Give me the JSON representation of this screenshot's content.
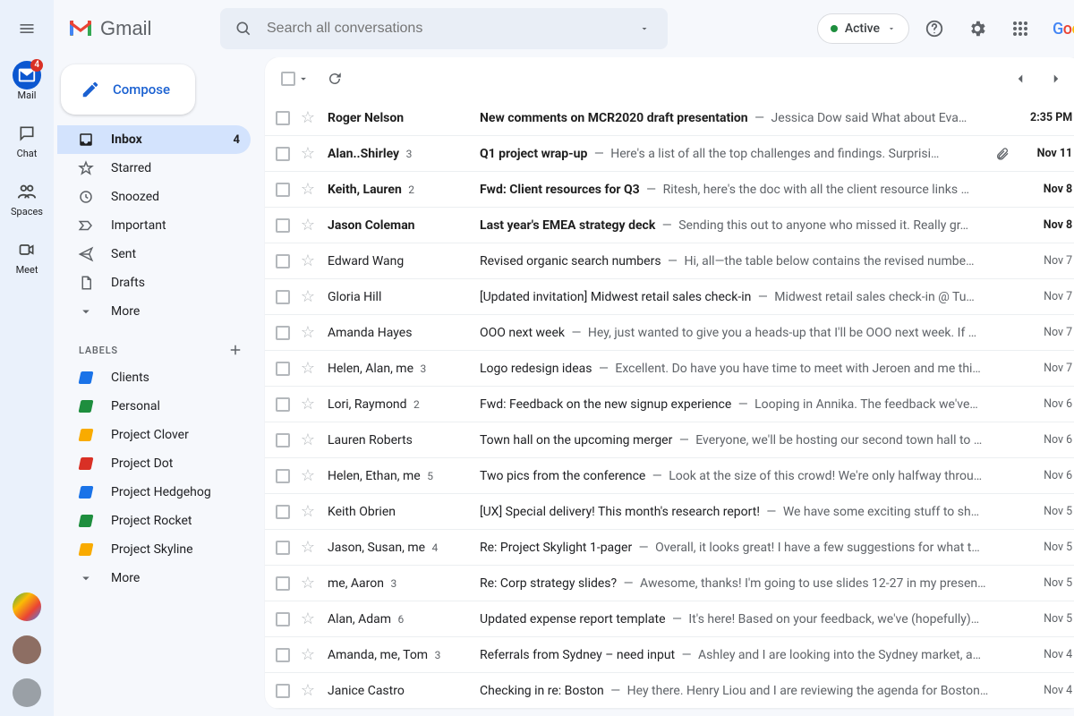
{
  "header": {
    "product": "Gmail",
    "search_placeholder": "Search all conversations",
    "status_label": "Active",
    "brand_word": "Google"
  },
  "apprail": {
    "items": [
      {
        "key": "mail",
        "label": "Mail",
        "badge": "4",
        "active": true
      },
      {
        "key": "chat",
        "label": "Chat"
      },
      {
        "key": "spaces",
        "label": "Spaces"
      },
      {
        "key": "meet",
        "label": "Meet"
      }
    ]
  },
  "sidebar": {
    "compose": "Compose",
    "nav": [
      {
        "key": "inbox",
        "label": "Inbox",
        "count": "4",
        "active": true
      },
      {
        "key": "starred",
        "label": "Starred"
      },
      {
        "key": "snoozed",
        "label": "Snoozed"
      },
      {
        "key": "important",
        "label": "Important"
      },
      {
        "key": "sent",
        "label": "Sent"
      },
      {
        "key": "drafts",
        "label": "Drafts"
      },
      {
        "key": "more",
        "label": "More"
      }
    ],
    "labels_header": "LABELS",
    "labels": [
      {
        "label": "Clients",
        "color": "#1a73e8"
      },
      {
        "label": "Personal",
        "color": "#1e8e3e"
      },
      {
        "label": "Project Clover",
        "color": "#f9ab00"
      },
      {
        "label": "Project Dot",
        "color": "#d93025"
      },
      {
        "label": "Project Hedgehog",
        "color": "#1a73e8"
      },
      {
        "label": "Project Rocket",
        "color": "#1e8e3e"
      },
      {
        "label": "Project Skyline",
        "color": "#f9ab00"
      }
    ],
    "labels_more": "More"
  },
  "mail": [
    {
      "unread": true,
      "from": "Roger Nelson",
      "count": "",
      "subject": "New comments on MCR2020 draft presentation",
      "snippet": "Jessica Dow said What about Eva…",
      "date": "2:35 PM",
      "attach": false
    },
    {
      "unread": true,
      "from": "Alan..Shirley",
      "count": "3",
      "subject": "Q1 project wrap-up",
      "snippet": "Here's a list of all the top challenges and findings. Surprisi…",
      "date": "Nov 11",
      "attach": true
    },
    {
      "unread": true,
      "from": "Keith, Lauren",
      "count": "2",
      "subject": "Fwd: Client resources for Q3",
      "snippet": "Ritesh, here's the doc with all the client resource links …",
      "date": "Nov 8",
      "attach": false
    },
    {
      "unread": true,
      "from": "Jason Coleman",
      "count": "",
      "subject": "Last year's EMEA strategy deck",
      "snippet": "Sending this out to anyone who missed it. Really gr…",
      "date": "Nov 8",
      "attach": false
    },
    {
      "unread": false,
      "from": "Edward Wang",
      "count": "",
      "subject": "Revised organic search numbers",
      "snippet": "Hi, all—the table below contains the revised numbe…",
      "date": "Nov 7",
      "attach": false
    },
    {
      "unread": false,
      "from": "Gloria Hill",
      "count": "",
      "subject": "[Updated invitation] Midwest retail sales check-in",
      "snippet": "Midwest retail sales check-in @ Tu…",
      "date": "Nov 7",
      "attach": false
    },
    {
      "unread": false,
      "from": "Amanda Hayes",
      "count": "",
      "subject": "OOO next week",
      "snippet": "Hey, just wanted to give you a heads-up that I'll be OOO next week. If …",
      "date": "Nov 7",
      "attach": false
    },
    {
      "unread": false,
      "from": "Helen, Alan, me",
      "count": "3",
      "subject": "Logo redesign ideas",
      "snippet": "Excellent. Do have you have time to meet with Jeroen and me thi…",
      "date": "Nov 7",
      "attach": false
    },
    {
      "unread": false,
      "from": "Lori, Raymond",
      "count": "2",
      "subject": "Fwd: Feedback on the new signup experience",
      "snippet": "Looping in Annika. The feedback we've…",
      "date": "Nov 6",
      "attach": false
    },
    {
      "unread": false,
      "from": "Lauren Roberts",
      "count": "",
      "subject": "Town hall on the upcoming merger",
      "snippet": "Everyone, we'll be hosting our second town hall to …",
      "date": "Nov 6",
      "attach": false
    },
    {
      "unread": false,
      "from": "Helen, Ethan, me",
      "count": "5",
      "subject": "Two pics from the conference",
      "snippet": "Look at the size of this crowd! We're only halfway throu…",
      "date": "Nov 6",
      "attach": false
    },
    {
      "unread": false,
      "from": "Keith Obrien",
      "count": "",
      "subject": "[UX] Special delivery! This month's research report!",
      "snippet": "We have some exciting stuff to sh…",
      "date": "Nov 5",
      "attach": false
    },
    {
      "unread": false,
      "from": "Jason, Susan, me",
      "count": "4",
      "subject": "Re: Project Skylight 1-pager",
      "snippet": "Overall, it looks great! I have a few suggestions for what t…",
      "date": "Nov 5",
      "attach": false
    },
    {
      "unread": false,
      "from": "me, Aaron",
      "count": "3",
      "subject": "Re: Corp strategy slides?",
      "snippet": "Awesome, thanks! I'm going to use slides 12-27 in my presen…",
      "date": "Nov 5",
      "attach": false
    },
    {
      "unread": false,
      "from": "Alan, Adam",
      "count": "6",
      "subject": "Updated expense report template",
      "snippet": "It's here! Based on your feedback, we've (hopefully)…",
      "date": "Nov 5",
      "attach": false
    },
    {
      "unread": false,
      "from": "Amanda, me, Tom",
      "count": "3",
      "subject": "Referrals from Sydney – need input",
      "snippet": "Ashley and I are looking into the Sydney market, a…",
      "date": "Nov 4",
      "attach": false
    },
    {
      "unread": false,
      "from": "Janice Castro",
      "count": "",
      "subject": "Checking in re: Boston",
      "snippet": "Hey there. Henry Liou and I are reviewing the agenda for Boston…",
      "date": "Nov 4",
      "attach": false
    }
  ],
  "rightrail": {
    "items": [
      {
        "key": "calendar",
        "color": "#4285f4"
      },
      {
        "key": "keep",
        "color": "#fbbc04"
      },
      {
        "key": "tasks",
        "color": "#1a73e8"
      },
      {
        "key": "contacts",
        "color": "#1a73e8"
      }
    ]
  }
}
